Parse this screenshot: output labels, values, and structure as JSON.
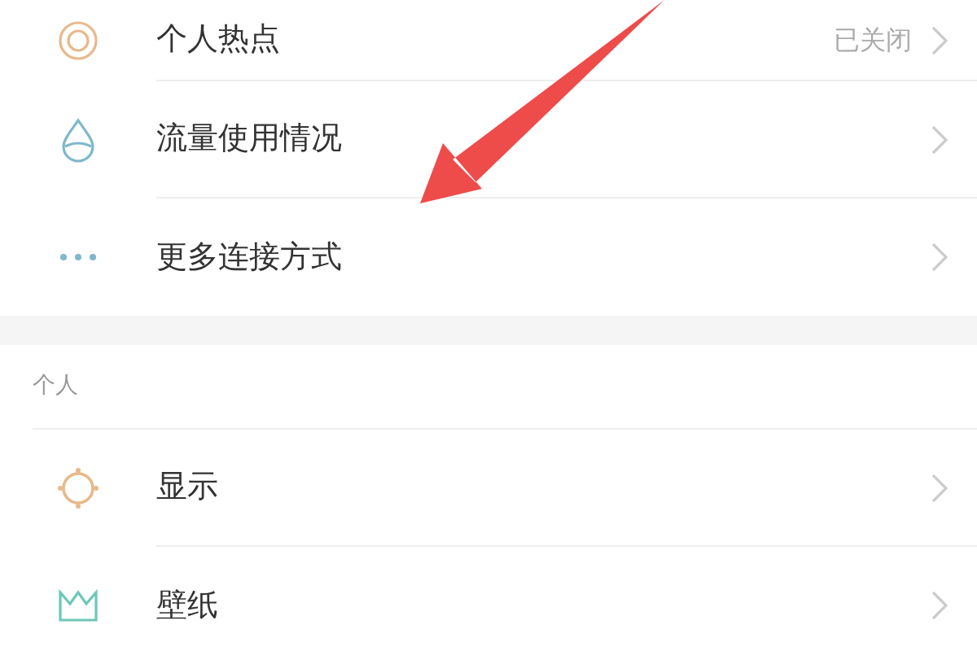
{
  "sections": [
    {
      "items": [
        {
          "label": "个人热点",
          "value": "已关闭"
        },
        {
          "label": "流量使用情况"
        },
        {
          "label": "更多连接方式"
        }
      ]
    },
    {
      "header": "个人",
      "items": [
        {
          "label": "显示"
        },
        {
          "label": "壁纸"
        }
      ]
    }
  ]
}
